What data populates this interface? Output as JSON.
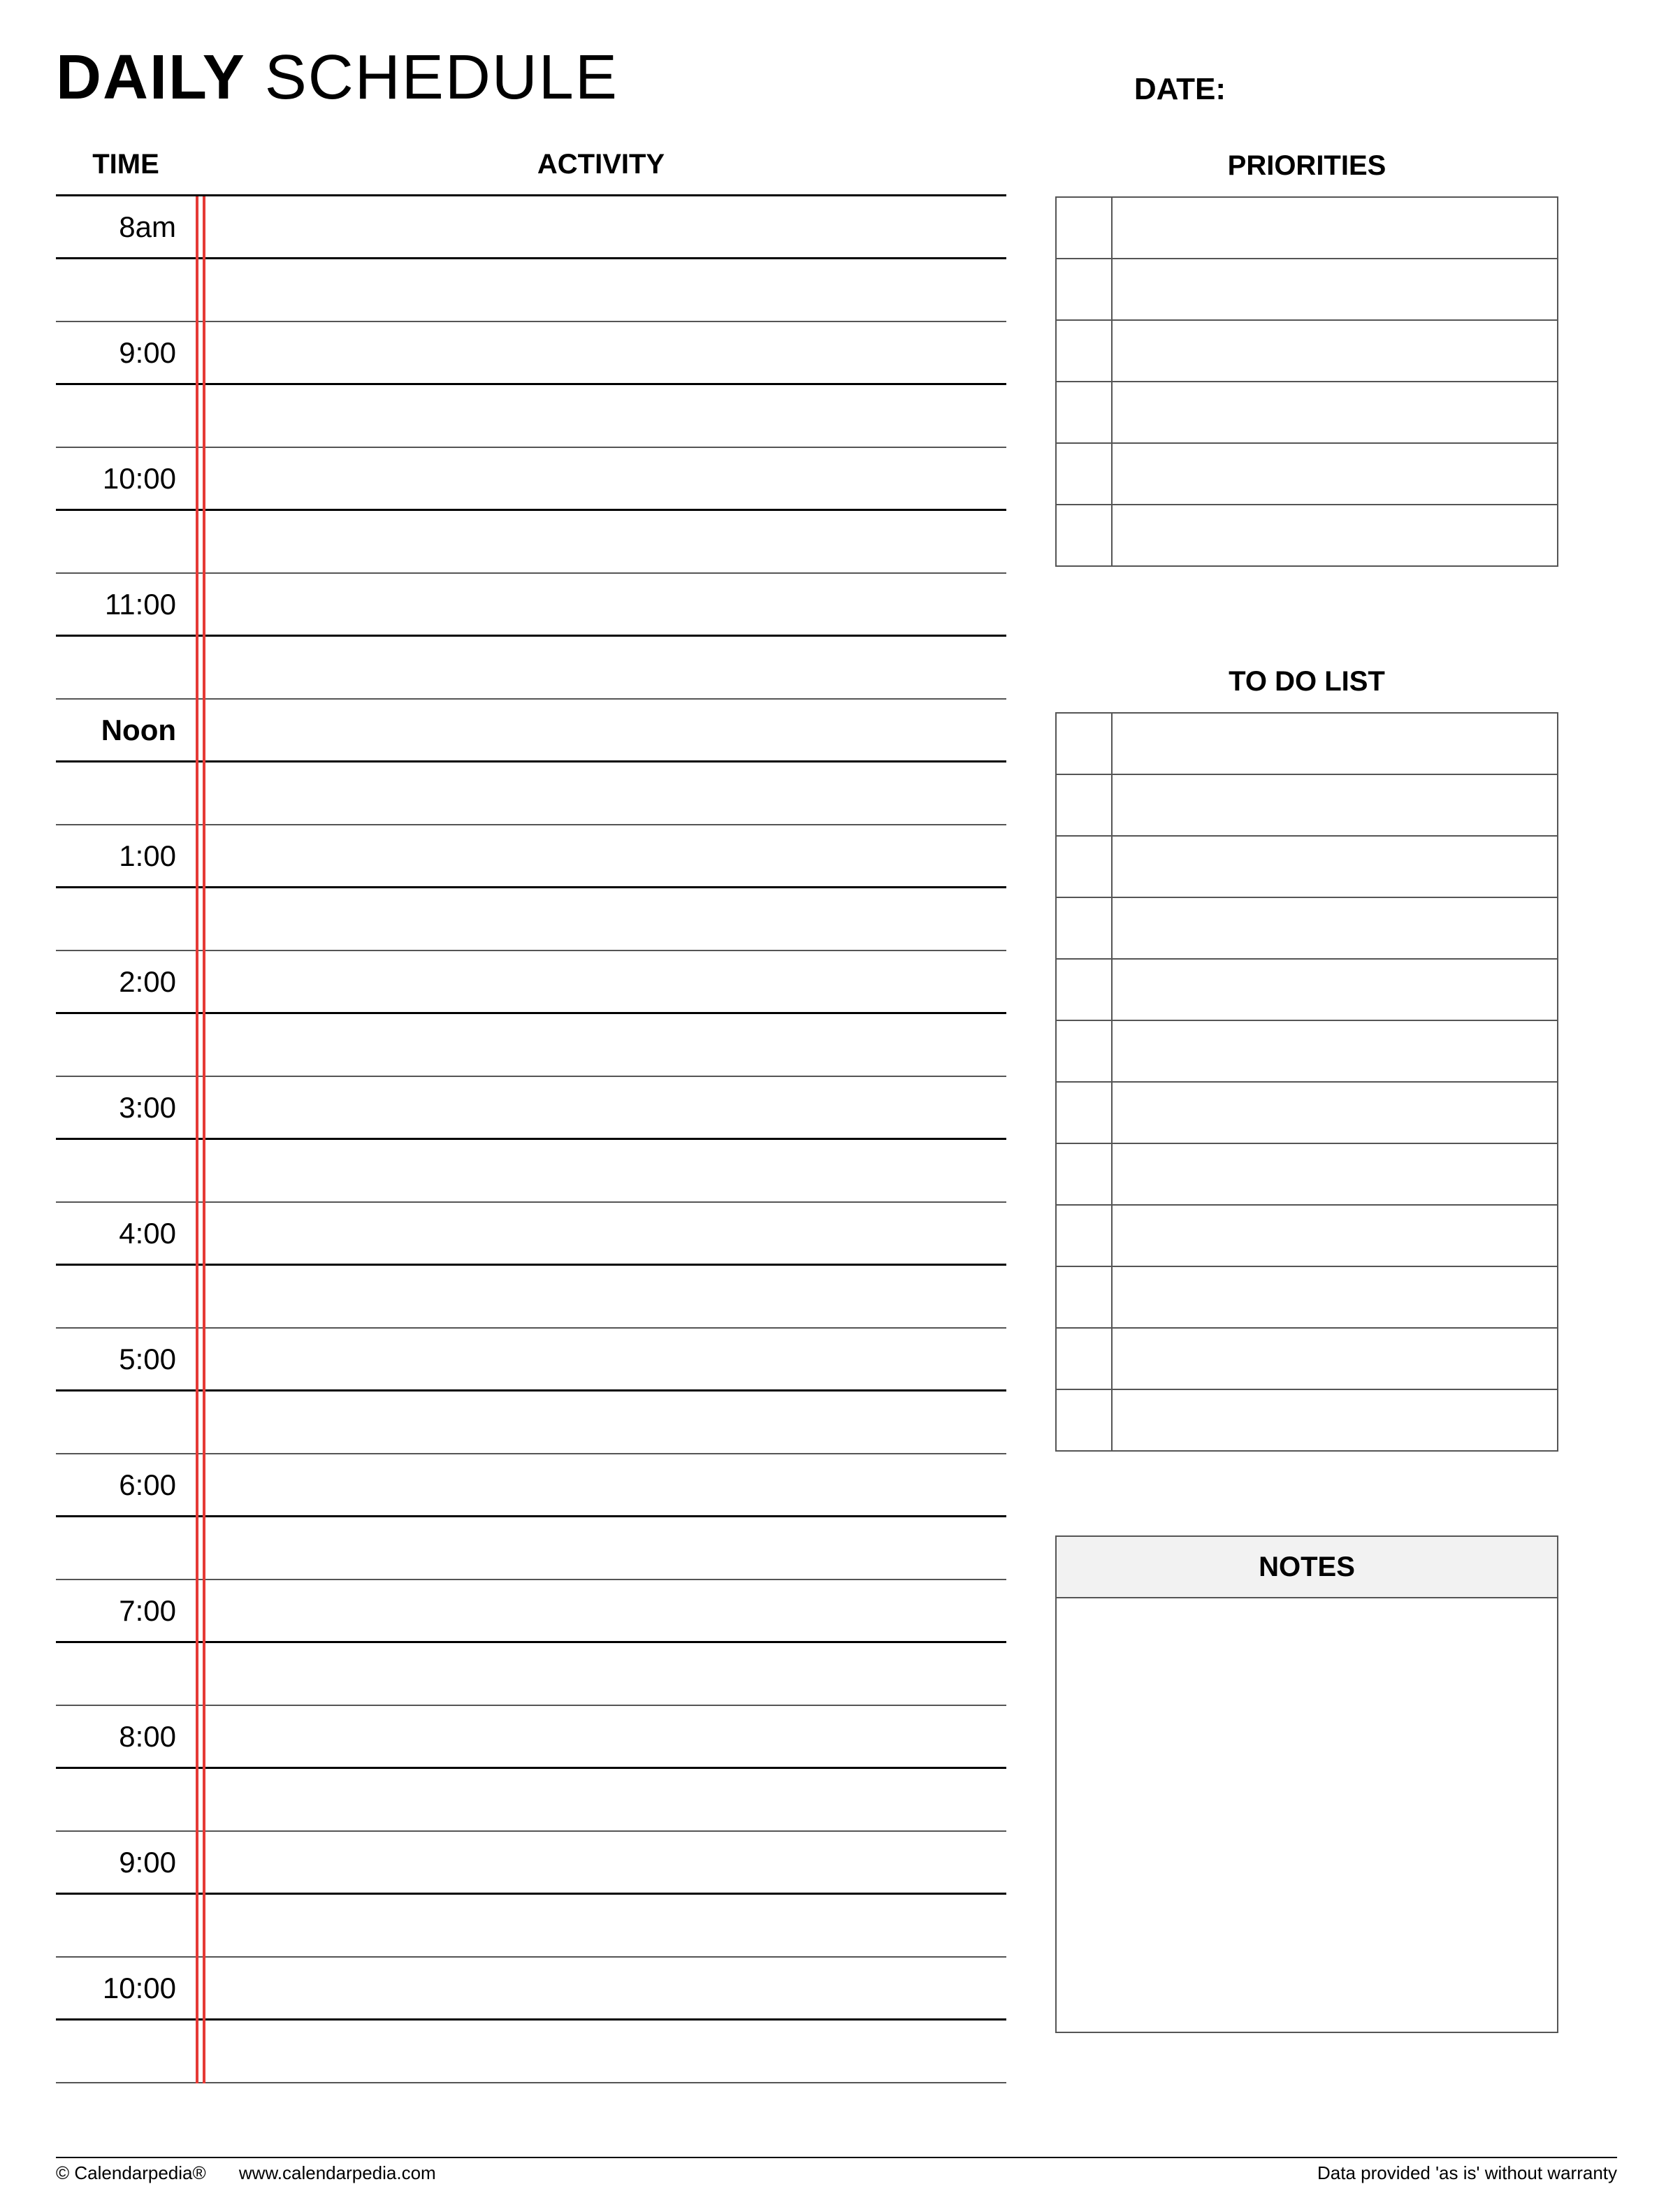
{
  "title": {
    "bold": "DAILY",
    "light": "SCHEDULE"
  },
  "date_label": "DATE:",
  "schedule": {
    "time_header": "TIME",
    "activity_header": "ACTIVITY",
    "rows": [
      {
        "label": "8am",
        "bold": false,
        "hour": true
      },
      {
        "label": "",
        "bold": false,
        "hour": false
      },
      {
        "label": "9:00",
        "bold": false,
        "hour": true
      },
      {
        "label": "",
        "bold": false,
        "hour": false
      },
      {
        "label": "10:00",
        "bold": false,
        "hour": true
      },
      {
        "label": "",
        "bold": false,
        "hour": false
      },
      {
        "label": "11:00",
        "bold": false,
        "hour": true
      },
      {
        "label": "",
        "bold": false,
        "hour": false
      },
      {
        "label": "Noon",
        "bold": true,
        "hour": true
      },
      {
        "label": "",
        "bold": false,
        "hour": false
      },
      {
        "label": "1:00",
        "bold": false,
        "hour": true
      },
      {
        "label": "",
        "bold": false,
        "hour": false
      },
      {
        "label": "2:00",
        "bold": false,
        "hour": true
      },
      {
        "label": "",
        "bold": false,
        "hour": false
      },
      {
        "label": "3:00",
        "bold": false,
        "hour": true
      },
      {
        "label": "",
        "bold": false,
        "hour": false
      },
      {
        "label": "4:00",
        "bold": false,
        "hour": true
      },
      {
        "label": "",
        "bold": false,
        "hour": false
      },
      {
        "label": "5:00",
        "bold": false,
        "hour": true
      },
      {
        "label": "",
        "bold": false,
        "hour": false
      },
      {
        "label": "6:00",
        "bold": false,
        "hour": true
      },
      {
        "label": "",
        "bold": false,
        "hour": false
      },
      {
        "label": "7:00",
        "bold": false,
        "hour": true
      },
      {
        "label": "",
        "bold": false,
        "hour": false
      },
      {
        "label": "8:00",
        "bold": false,
        "hour": true
      },
      {
        "label": "",
        "bold": false,
        "hour": false
      },
      {
        "label": "9:00",
        "bold": false,
        "hour": true
      },
      {
        "label": "",
        "bold": false,
        "hour": false
      },
      {
        "label": "10:00",
        "bold": false,
        "hour": true
      },
      {
        "label": "",
        "bold": false,
        "hour": false
      }
    ]
  },
  "priorities": {
    "title": "PRIORITIES",
    "count": 6
  },
  "todo": {
    "title": "TO DO LIST",
    "count": 12
  },
  "notes": {
    "title": "NOTES"
  },
  "footer": {
    "copyright": "© Calendarpedia®",
    "url": "www.calendarpedia.com",
    "disclaimer": "Data provided 'as is' without warranty"
  }
}
